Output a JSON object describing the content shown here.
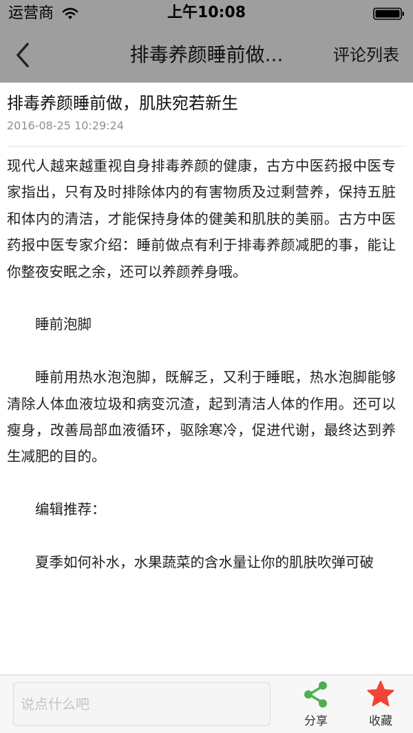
{
  "status_bar": {
    "carrier": "运营商",
    "time": "上午10:08"
  },
  "nav": {
    "title": "排毒养颜睡前做...",
    "comments_label": "评论列表"
  },
  "article": {
    "title": "排毒养颜睡前做，肌肤宛若新生",
    "date": "2016-08-25 10:29:24",
    "paragraphs": [
      "现代人越来越重视自身排毒养颜的健康，古方中医药报中医专家指出，只有及时排除体内的有害物质及过剩营养，保持五脏和体内的清洁，才能保持身体的健美和肌肤的美丽。古方中医药报中医专家介绍：睡前做点有利于排毒养颜减肥的事，能让你整夜安眠之余，还可以养颜养身哦。",
      "睡前泡脚",
      "睡前用热水泡泡脚，既解乏，又利于睡眠，热水泡脚能够清除人体血液垃圾和病变沉渣，起到清洁人体的作用。还可以瘦身，改善局部血液循环，驱除寒冷，促进代谢，最终达到养生减肥的目的。",
      "编辑推荐：",
      "夏季如何补水，水果蔬菜的含水量让你的肌肤吹弹可破"
    ]
  },
  "toolbar": {
    "comment_placeholder": "说点什么吧",
    "share_label": "分享",
    "favorite_label": "收藏",
    "share_color": "#4caf50",
    "favorite_color": "#f44336"
  },
  "icons": {
    "back": "chevron-left-icon",
    "wifi": "wifi-icon",
    "battery": "battery-icon",
    "share": "share-icon",
    "favorite": "star-icon"
  }
}
